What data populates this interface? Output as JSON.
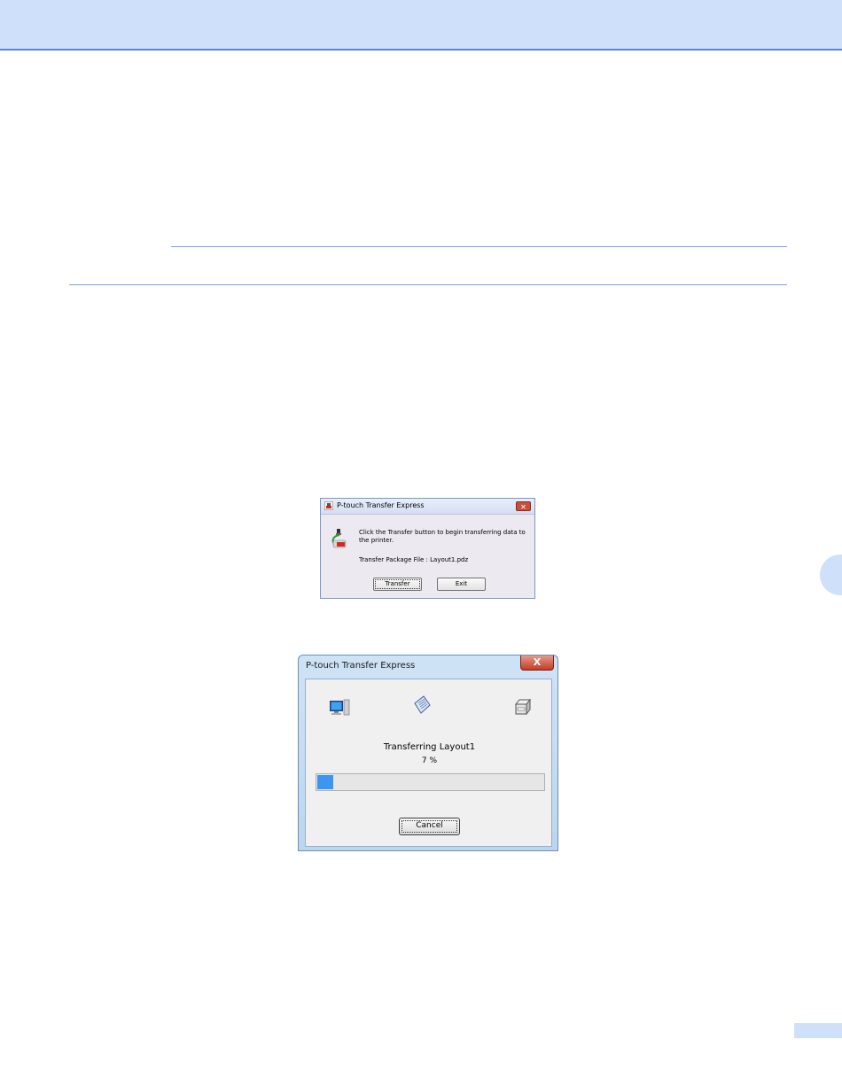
{
  "dialog_small": {
    "title": "P-touch Transfer Express",
    "close_label": "✕",
    "message": "Click the Transfer button to begin transferring data to the printer.",
    "file_line": "Transfer Package File : Layout1.pdz",
    "transfer_label": "Transfer",
    "exit_label": "Exit",
    "icons": [
      "app-icon",
      "transfer-icon"
    ]
  },
  "dialog_progress": {
    "title": "P-touch Transfer Express",
    "close_label": "X",
    "status": "Transferring Layout1",
    "percent_text": "7 %",
    "progress_fraction": 0.07,
    "cancel_label": "Cancel",
    "icons": [
      "computer-icon",
      "document-icon",
      "printer-icon"
    ]
  },
  "colors": {
    "page_accent": "#cfe0fb",
    "rule": "#7ba2e0",
    "progress_fill": "#3a96f0"
  }
}
